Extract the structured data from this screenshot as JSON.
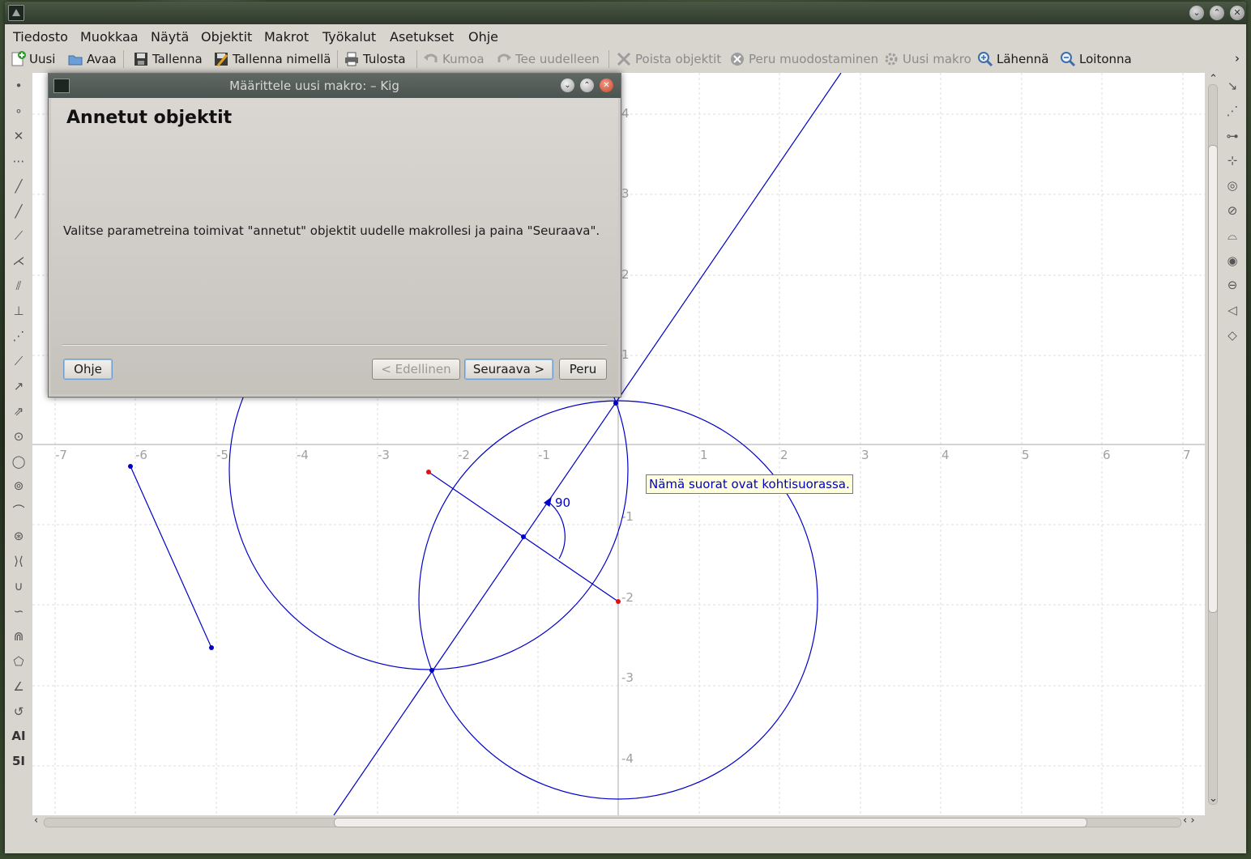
{
  "app": {
    "title": "",
    "window_buttons": [
      "minimize",
      "maximize",
      "close"
    ]
  },
  "menubar": [
    "Tiedosto",
    "Muokkaa",
    "Näytä",
    "Objektit",
    "Makrot",
    "Työkalut",
    "Asetukset",
    "Ohje"
  ],
  "toolbar": {
    "new": "Uusi",
    "open": "Avaa",
    "save": "Tallenna",
    "save_as": "Tallenna nimellä",
    "print": "Tulosta",
    "undo": "Kumoa",
    "redo": "Tee uudelleen",
    "delete": "Poista objektit",
    "cancel_construction": "Peru muodostaminen",
    "new_macro": "Uusi makro",
    "zoom_in": "Lähennä",
    "zoom_out": "Loitonna",
    "overflow": "›"
  },
  "dialog": {
    "title": "Määrittele uusi makro: – Kig",
    "heading": "Annetut objektit",
    "text": "Valitse parametreina toimivat \"annetut\" objektit uudelle makrollesi ja paina \"Seuraava\".",
    "help_button": "Ohje",
    "back_button": "< Edellinen",
    "next_button": "Seuraava >",
    "cancel_button": "Peru"
  },
  "canvas": {
    "x_ticks": [
      "-7",
      "-6",
      "-5",
      "-4",
      "-3",
      "-2",
      "-1",
      "1",
      "2",
      "3",
      "4",
      "5",
      "6",
      "7"
    ],
    "y_ticks": [
      "4",
      "3",
      "2",
      "1",
      "-1",
      "-2",
      "-3",
      "-4"
    ],
    "angle_label": "90",
    "tooltip": "Nämä suorat ovat kohtisuorassa."
  },
  "left_tools": [
    "point-icon",
    "constrained-point-icon",
    "intersection-icon",
    "midpoint-icon",
    "line-icon",
    "ray-icon",
    "segment-icon",
    "angle-bisector-icon",
    "parallel-icon",
    "perpendicular-icon",
    "segment-axis-icon",
    "tangent-icon",
    "vector-icon",
    "vector-sum-icon",
    "circle-center-point-icon",
    "circle-three-points-icon",
    "circle-center-radius-icon",
    "arc-icon",
    "conic-icon",
    "hyperbola-icon",
    "parabola-icon",
    "cubic-icon",
    "locus-icon",
    "polygon-icon",
    "angle-icon",
    "transform-icon",
    "text-label-icon",
    "numeric-label-icon"
  ],
  "left_tool_glyphs": [
    "•",
    "∘",
    "✕",
    "⋯",
    "╱",
    "╱",
    "⟋",
    "⋌",
    "⫽",
    "⊥",
    "⋰",
    "⟋",
    "↗",
    "⇗",
    "⊙",
    "◯",
    "⊚",
    "⌒",
    "⊛",
    "⟩⟨",
    "∪",
    "∽",
    "⋒",
    "⬠",
    "∠",
    "↺",
    "AI",
    "5I"
  ],
  "right_tools": [
    "translate-icon",
    "rotate-icon",
    "reflect-point-icon",
    "reflect-line-icon",
    "scale-icon",
    "invert-icon",
    "homothety-icon",
    "circle-inversion-icon",
    "projective-icon",
    "affinity-icon",
    "similitude-icon"
  ],
  "right_tool_glyphs": [
    "↘",
    "⋰",
    "⊶",
    "⊹",
    "◎",
    "⊘",
    "⌓",
    "◉",
    "⊖",
    "◁",
    "◇"
  ]
}
